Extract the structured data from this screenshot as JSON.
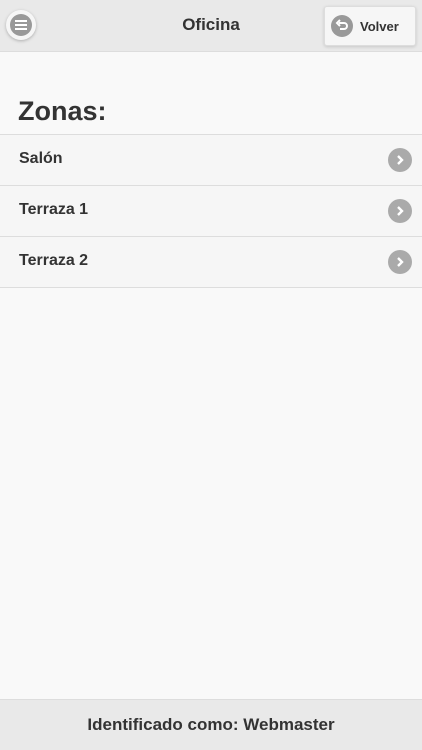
{
  "header": {
    "title": "Oficina",
    "menu_icon": "menu-icon",
    "back_label": "Volver",
    "back_icon": "back-arrow-icon"
  },
  "main": {
    "section_title": "Zonas:",
    "zones": [
      {
        "label": "Salón",
        "icon": "chevron-right-icon"
      },
      {
        "label": "Terraza 1",
        "icon": "chevron-right-icon"
      },
      {
        "label": "Terraza 2",
        "icon": "chevron-right-icon"
      }
    ]
  },
  "footer": {
    "text": "Identificado como: Webmaster"
  },
  "colors": {
    "header_bg": "#e9e9e9",
    "page_bg": "#f9f9f9",
    "icon_gray": "#999999",
    "text": "#333333"
  }
}
